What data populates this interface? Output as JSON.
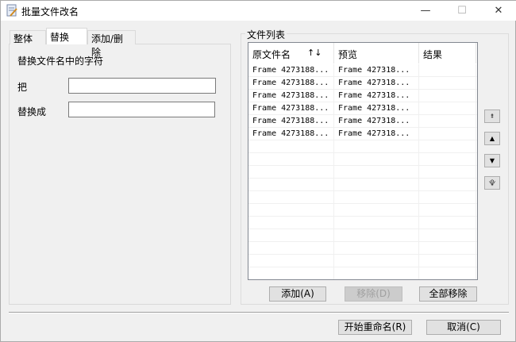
{
  "window": {
    "title": "批量文件改名",
    "minimize": "—",
    "maximize": "☐",
    "close": "✕"
  },
  "tabs": [
    {
      "label": "整体"
    },
    {
      "label": "替换"
    },
    {
      "label": "添加/删除"
    }
  ],
  "replace": {
    "heading": "替换文件名中的字符",
    "from_label": "把",
    "from_value": "",
    "to_label": "替换成",
    "to_value": ""
  },
  "file_list": {
    "group_label": "文件列表",
    "columns": [
      "原文件名",
      "预览",
      "结果"
    ],
    "sort_icon": "↑↓",
    "rows": [
      {
        "original": "Frame 4273188...",
        "preview": "Frame 427318...",
        "result": ""
      },
      {
        "original": "Frame 4273188...",
        "preview": "Frame 427318...",
        "result": ""
      },
      {
        "original": "Frame 4273188...",
        "preview": "Frame 427318...",
        "result": ""
      },
      {
        "original": "Frame 4273188...",
        "preview": "Frame 427318...",
        "result": ""
      },
      {
        "original": "Frame 4273188...",
        "preview": "Frame 427318...",
        "result": ""
      },
      {
        "original": "Frame 4273188...",
        "preview": "Frame 427318...",
        "result": ""
      }
    ]
  },
  "list_buttons": {
    "add": "添加(A)",
    "remove": "移除(D)",
    "remove_all": "全部移除"
  },
  "move_buttons": {
    "top": "⯒",
    "up": "▲",
    "down": "▼",
    "bottom": "⯓"
  },
  "footer": {
    "start": "开始重命名(R)",
    "cancel": "取消(C)"
  }
}
